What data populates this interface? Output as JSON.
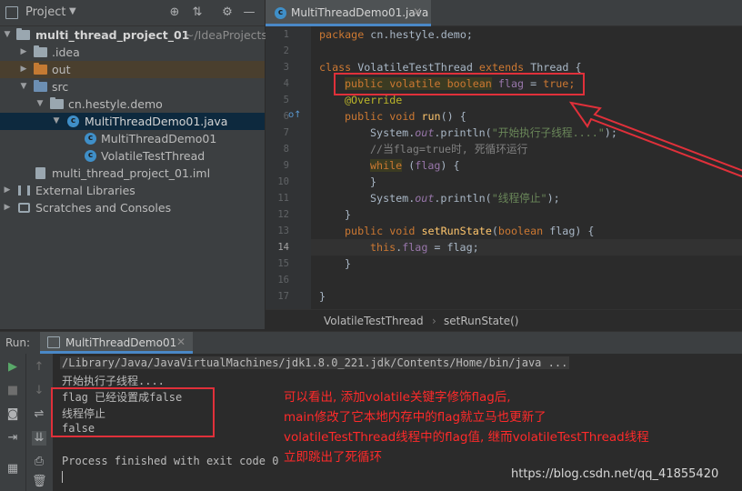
{
  "project_panel": {
    "title": "Project",
    "tree": [
      {
        "label": "multi_thread_project_01",
        "suffix": "~/IdeaProjects"
      },
      {
        "label": ".idea"
      },
      {
        "label": "out"
      },
      {
        "label": "src"
      },
      {
        "label": "cn.hestyle.demo"
      },
      {
        "label": "MultiThreadDemo01.java"
      },
      {
        "label": "MultiThreadDemo01"
      },
      {
        "label": "VolatileTestThread"
      },
      {
        "label": "multi_thread_project_01.iml"
      },
      {
        "label": "External Libraries"
      },
      {
        "label": "Scratches and Consoles"
      }
    ]
  },
  "editor": {
    "tab_label": "MultiThreadDemo01.java",
    "line_numbers": [
      "1",
      "2",
      "3",
      "4",
      "5",
      "6",
      "7",
      "8",
      "9",
      "10",
      "11",
      "12",
      "13",
      "14",
      "15",
      "16",
      "17"
    ],
    "code": {
      "l1_kw": "package",
      "l1_rest": " cn.hestyle.demo;",
      "l3_kw1": "class",
      "l3_name": " VolatileTestThread ",
      "l3_kw2": "extends",
      "l3_rest": " Thread {",
      "l4_kw": "public volatile boolean",
      "l4_fld": "flag",
      "l4_eq": " = ",
      "l4_val": "true",
      "l4_end": ";",
      "l5_ann": "@Override",
      "l6_kw": "public void",
      "l6_mth": "run",
      "l6_rest": "() {",
      "l7_a": "System.",
      "l7_out": "out",
      "l7_b": ".println(",
      "l7_str": "\"开始执行子线程....\"",
      "l7_c": ");",
      "l8_cm": "//当flag=true时, 死循环运行",
      "l9_kw": "while",
      "l9_a": " (",
      "l9_fld": "flag",
      "l9_b": ") {",
      "l10": "}",
      "l11_a": "System.",
      "l11_out": "out",
      "l11_b": ".println(",
      "l11_str": "\"线程停止\"",
      "l11_c": ");",
      "l12": "}",
      "l13_kw": "public void",
      "l13_mth": "setRunState",
      "l13_a": "(",
      "l13_kw2": "boolean",
      "l13_b": " flag) {",
      "l14_kw": "this",
      "l14_a": ".",
      "l14_fld": "flag",
      "l14_b": " = flag;",
      "l15": "}",
      "l17": "}"
    },
    "breadcrumb": [
      "VolatileTestThread",
      "setRunState()"
    ]
  },
  "run_panel": {
    "label": "Run:",
    "tab_label": "MultiThreadDemo01",
    "console": [
      "/Library/Java/JavaVirtualMachines/jdk1.8.0_221.jdk/Contents/Home/bin/java ...",
      "开始执行子线程....",
      "flag 已经设置成false",
      "线程停止",
      "false",
      "",
      "Process finished with exit code 0"
    ]
  },
  "annotation": {
    "lines": [
      "可以看出, 添加volatile关键字修饰flag后,",
      "main修改了它本地内存中的flag就立马也更新了",
      "volatileTestThread线程中的flag值, 继而volatileTestThread线程",
      "立即跳出了死循环"
    ]
  },
  "watermark": "https://blog.csdn.net/qq_41855420",
  "colors": {
    "highlight_box": "#e0303a",
    "annotation_text": "#ff2a2a",
    "selection": "#0d293e"
  }
}
